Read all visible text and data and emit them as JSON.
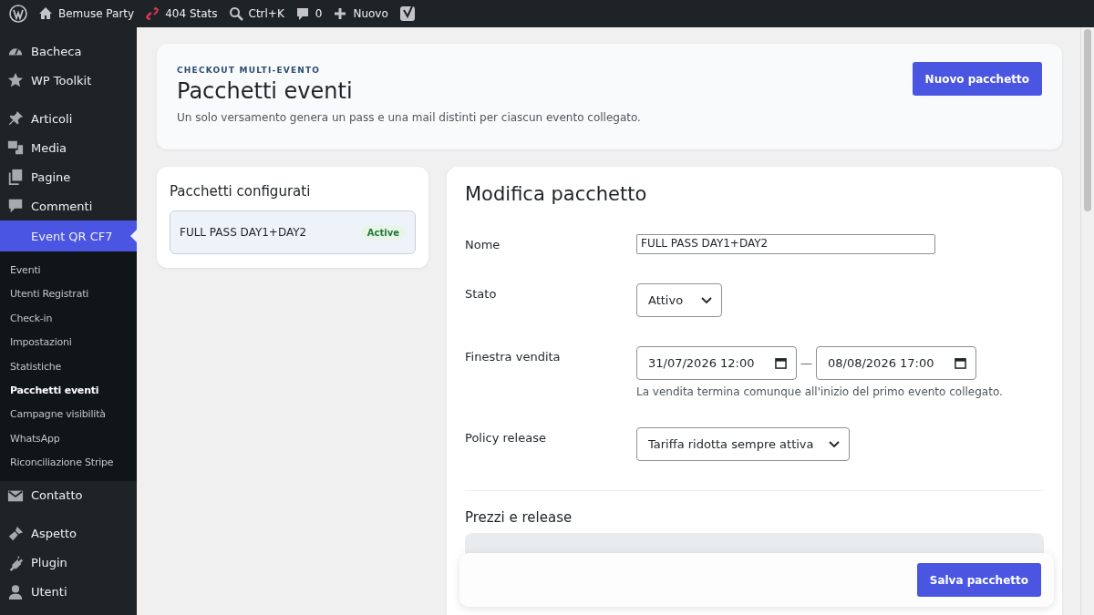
{
  "admin_bar": {
    "site": "Bemuse Party",
    "stats": "404 Stats",
    "search": "Ctrl+K",
    "comments": "0",
    "new": "Nuovo"
  },
  "sidebar": {
    "items": [
      {
        "label": "Bacheca",
        "selected": false
      },
      {
        "label": "WP Toolkit",
        "selected": false
      },
      {
        "label": "Articoli",
        "selected": false
      },
      {
        "label": "Media",
        "selected": false
      },
      {
        "label": "Pagine",
        "selected": false
      },
      {
        "label": "Commenti",
        "selected": false
      },
      {
        "label": "Event QR CF7",
        "selected": true,
        "children": [
          {
            "label": "Eventi",
            "selected": false
          },
          {
            "label": "Utenti Registrati",
            "selected": false
          },
          {
            "label": "Check-in",
            "selected": false
          },
          {
            "label": "Impostazioni",
            "selected": false
          },
          {
            "label": "Statistiche",
            "selected": false
          },
          {
            "label": "Pacchetti eventi",
            "selected": true
          },
          {
            "label": "Campagne visibilità",
            "selected": false
          },
          {
            "label": "WhatsApp",
            "selected": false
          },
          {
            "label": "Riconciliazione Stripe",
            "selected": false
          }
        ]
      },
      {
        "label": "Contatto",
        "selected": false
      },
      {
        "label": "Aspetto",
        "selected": false
      },
      {
        "label": "Plugin",
        "selected": false
      },
      {
        "label": "Utenti",
        "selected": false
      }
    ]
  },
  "header": {
    "eyebrow": "CHECKOUT MULTI-EVENTO",
    "title": "Pacchetti eventi",
    "description": "Un solo versamento genera un pass e una mail distinti per ciascun evento collegato.",
    "button": "Nuovo pacchetto"
  },
  "packages": {
    "title": "Pacchetti configurati",
    "items": [
      {
        "name": "FULL PASS DAY1+DAY2",
        "status": "Active",
        "selected": true
      }
    ]
  },
  "editor": {
    "title": "Modifica pacchetto",
    "fields": [
      {
        "kind": "text",
        "label": "Nome",
        "value": "FULL PASS DAY1+DAY2"
      },
      {
        "kind": "select",
        "label": "Stato",
        "value": "Attivo"
      },
      {
        "kind": "range",
        "label": "Finestra vendita",
        "start": "31/07/2026 12:00",
        "separator": "—",
        "end": "08/08/2026 17:00",
        "help": "La vendita termina comunque all'inizio del primo evento collegato."
      },
      {
        "kind": "select",
        "label": "Policy release",
        "value": "Tariffa ridotta sempre attiva"
      }
    ],
    "prices_title": "Prezzi e release"
  },
  "save_button": "Salva pacchetto"
}
